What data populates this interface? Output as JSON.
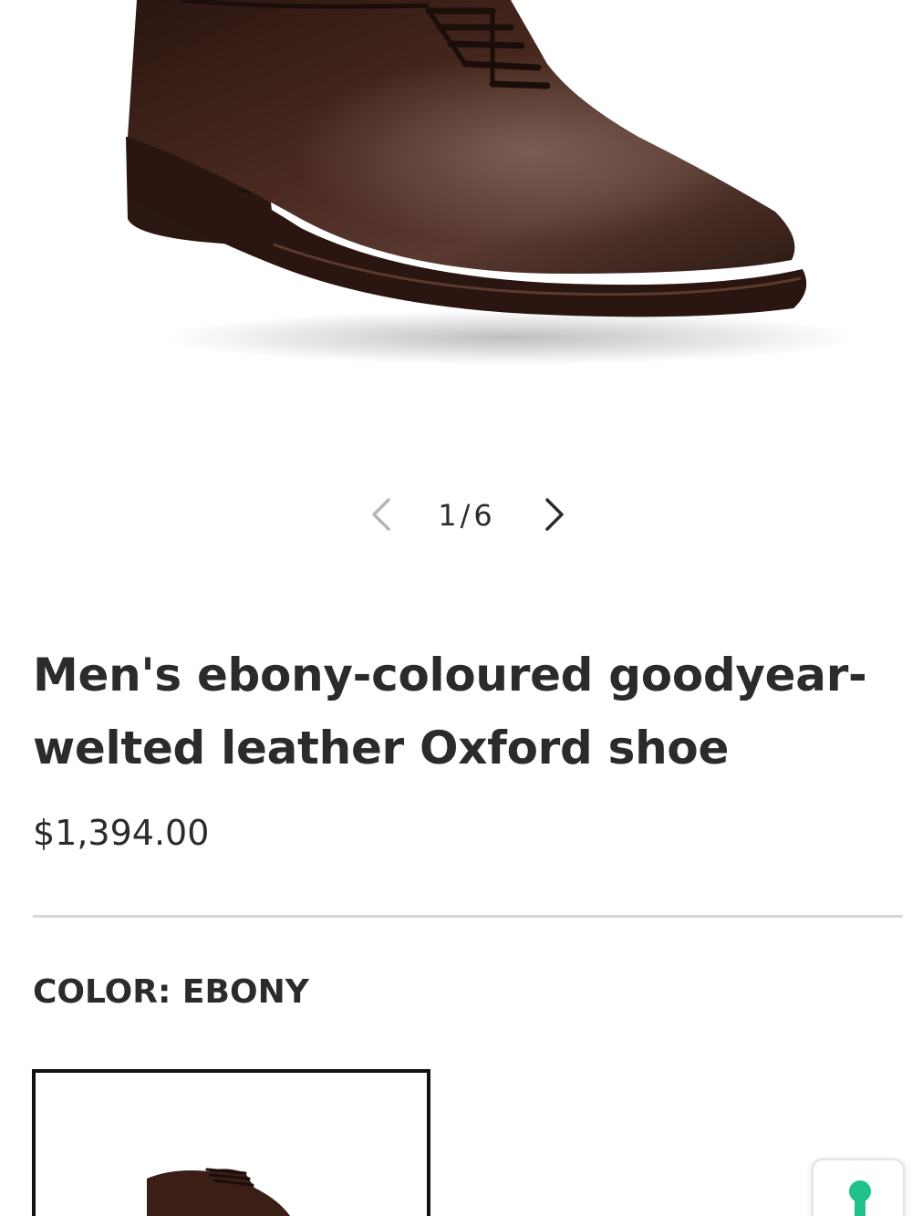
{
  "gallery": {
    "current": "1",
    "total": "6",
    "counter": "1/6",
    "image_icon": "oxford-shoe-photo",
    "prev_icon": "chevron-left-icon",
    "next_icon": "chevron-right-icon"
  },
  "product": {
    "title": "Men's ebony-coloured goodyear-welted leather Oxford shoe",
    "price": "$1,394.00"
  },
  "color": {
    "label": "COLOR: EBONY",
    "swatch_icon": "oxford-shoe-thumbnail"
  },
  "widget": {
    "icon": "keyhole-icon",
    "accent": "#1fc28a"
  },
  "colors": {
    "text": "#2b2b2b",
    "divider": "#d7d7d7",
    "shoe": "#3b1f17"
  }
}
